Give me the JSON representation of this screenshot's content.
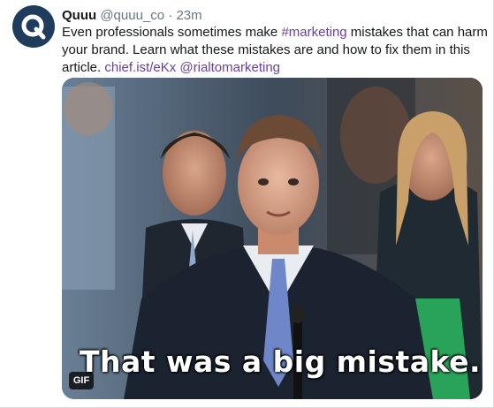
{
  "tweet": {
    "display_name": "Quuu",
    "handle": "@quuu_co",
    "separator": "·",
    "timestamp": "23m",
    "text": {
      "line1_before": "Even professionals sometimes make ",
      "hashtag": "#marketing",
      "line1_after": " mistakes that can harm",
      "line2": "your brand. Learn what these mistakes are and how to fix them in this",
      "line3_before": "article. ",
      "link": "chief.ist/eKx",
      "line3_space": " ",
      "mention": "@rialtomarketing"
    },
    "media": {
      "caption": "That was a big mistake.",
      "badge": "GIF"
    }
  },
  "colors": {
    "link": "#6b3fa0",
    "avatar_bg": "#1f3c5d",
    "muted_text": "#657786"
  },
  "icons": {
    "avatar": "quuu-logo-q"
  }
}
